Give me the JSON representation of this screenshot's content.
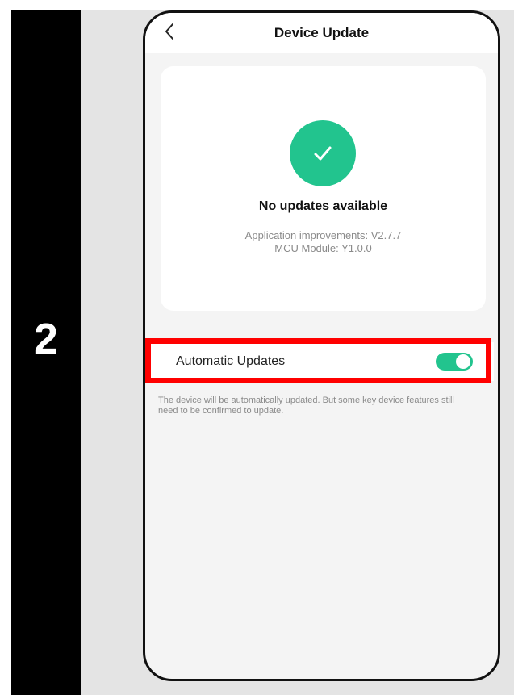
{
  "step": {
    "number": "2"
  },
  "header": {
    "title": "Device Update",
    "back_icon": "chevron-left-icon"
  },
  "status_card": {
    "icon": "check-circle-icon",
    "icon_color": "#22c48e",
    "title": "No updates available",
    "versions": [
      "Application improvements: V2.7.7",
      "MCU Module: Y1.0.0"
    ]
  },
  "auto_updates": {
    "label": "Automatic Updates",
    "enabled": true,
    "toggle_color": "#22c48e",
    "highlight_color": "#ff0000",
    "description": "The device will be automatically updated. But some key device features still need to be confirmed to update."
  }
}
